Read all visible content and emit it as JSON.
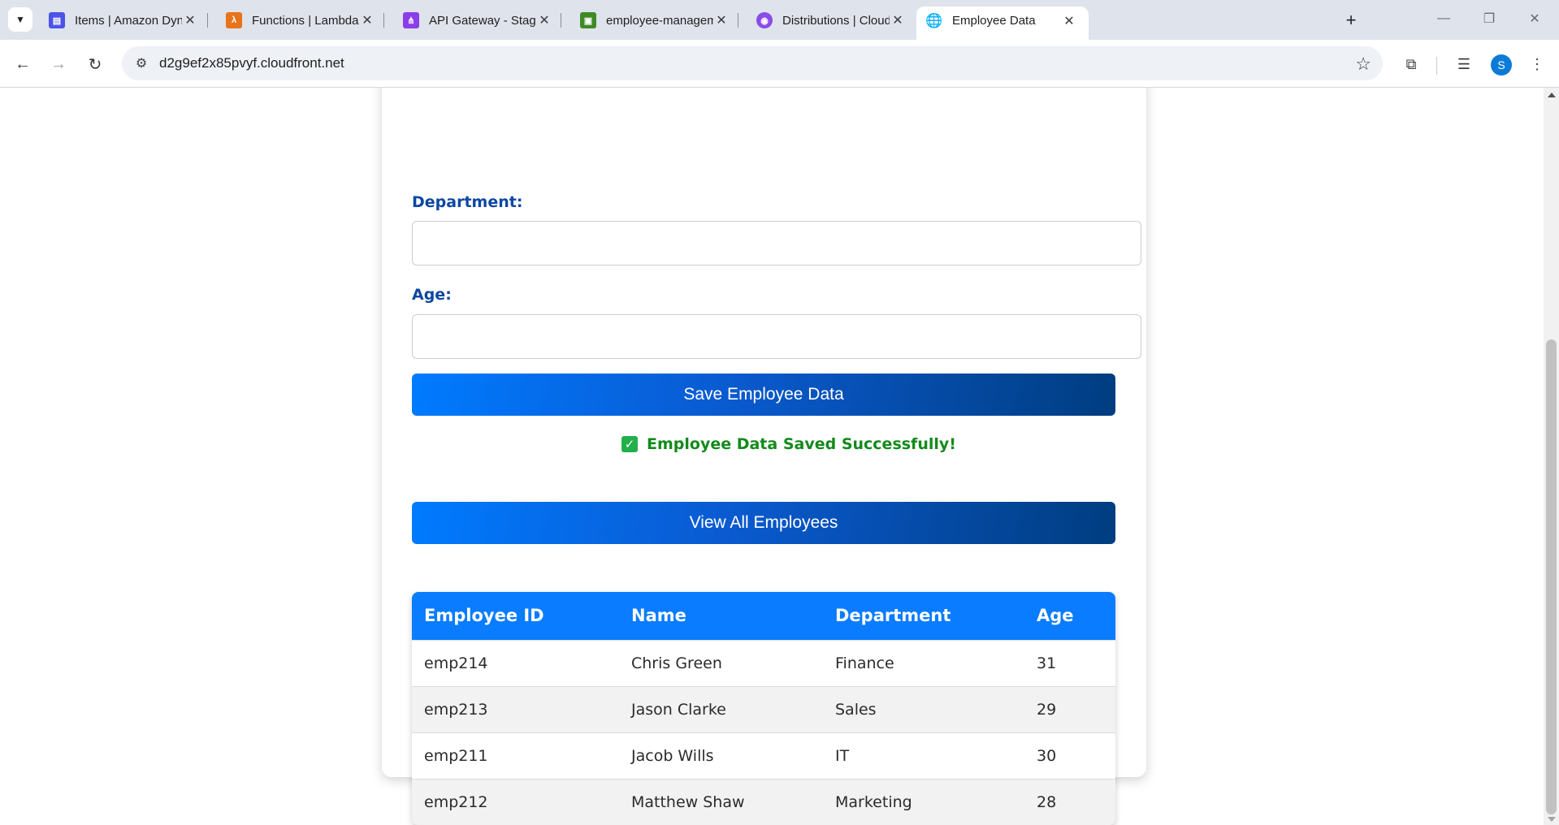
{
  "browser": {
    "tabs": [
      {
        "title": "Items | Amazon DynamoDB",
        "favicon_color": "#4b53e8",
        "favicon_glyph": "dynamodb-icon"
      },
      {
        "title": "Functions | Lambda",
        "favicon_color": "#e8731a",
        "favicon_glyph": "lambda-icon"
      },
      {
        "title": "API Gateway - Stages",
        "favicon_color": "#8a3ee8",
        "favicon_glyph": "api-gateway-icon"
      },
      {
        "title": "employee-management-sy",
        "favicon_color": "#3f8a24",
        "favicon_glyph": "s3-icon"
      },
      {
        "title": "Distributions | CloudFront",
        "favicon_color": "#8a4ce8",
        "favicon_glyph": "cloudfront-icon"
      },
      {
        "title": "Employee Data",
        "favicon_color": "#5f6368",
        "favicon_glyph": "globe-icon",
        "active": true
      }
    ],
    "url": "d2g9ef2x85pvyf.cloudfront.net",
    "profile_initial": "S"
  },
  "form": {
    "department_label": "Department:",
    "department_value": "",
    "age_label": "Age:",
    "age_value": "",
    "save_button": "Save Employee Data",
    "success_message": "Employee Data Saved Successfully!",
    "view_all_button": "View All Employees"
  },
  "table": {
    "headers": [
      "Employee ID",
      "Name",
      "Department",
      "Age"
    ],
    "rows": [
      [
        "emp214",
        "Chris Green",
        "Finance",
        "31"
      ],
      [
        "emp213",
        "Jason Clarke",
        "Sales",
        "29"
      ],
      [
        "emp211",
        "Jacob Wills",
        "IT",
        "30"
      ],
      [
        "emp212",
        "Matthew Shaw",
        "Marketing",
        "28"
      ]
    ]
  },
  "colors": {
    "label_blue": "#0d47a1",
    "button_gradient_start": "#007bff",
    "button_gradient_end": "#003d80",
    "success_green": "#138a1b",
    "table_header": "#0a7cff"
  }
}
